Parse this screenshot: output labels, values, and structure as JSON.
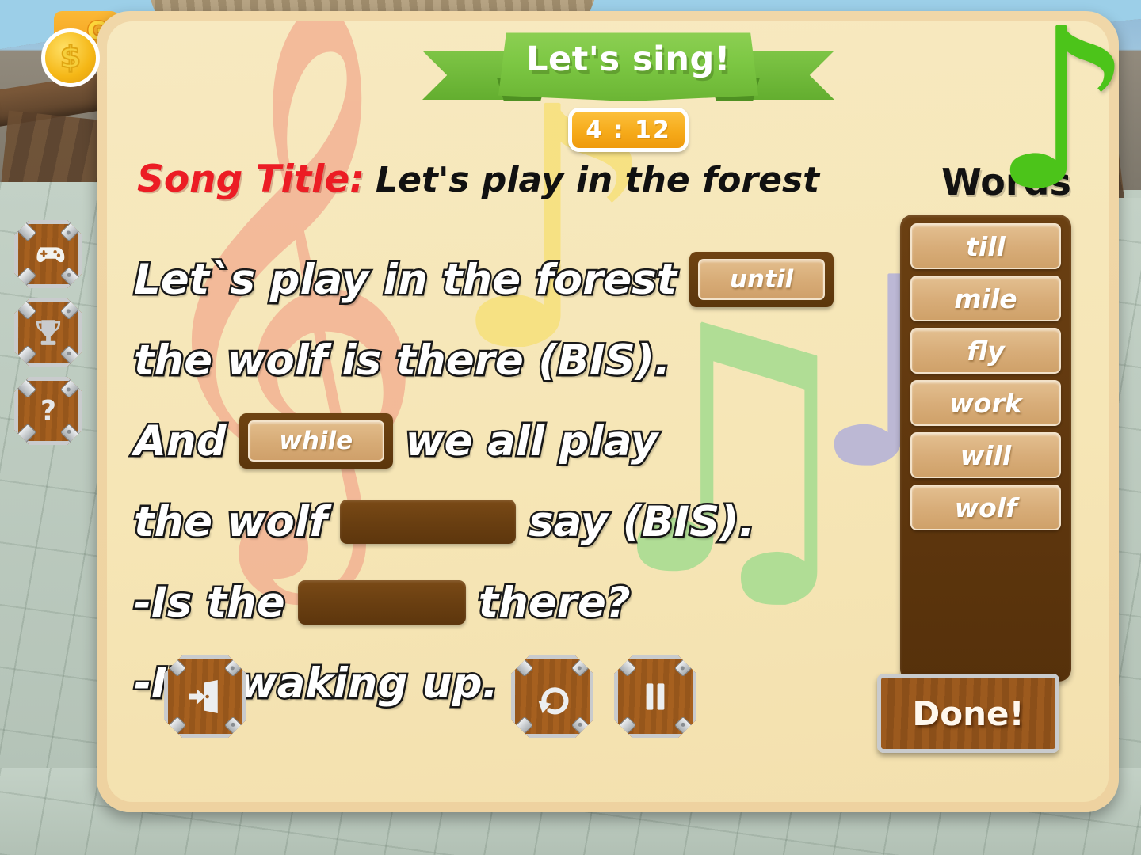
{
  "hud": {
    "gold_label": "Gold",
    "coin_icon": "gold-coin-icon"
  },
  "sidebar": {
    "items": [
      {
        "icon": "gamepad-icon",
        "name": "games"
      },
      {
        "icon": "trophy-icon",
        "name": "achievements"
      },
      {
        "icon": "question-mark-icon",
        "name": "help"
      }
    ]
  },
  "banner": {
    "title": "Let's sing!",
    "timer": "4 : 12"
  },
  "header": {
    "song_label": "Song Title:",
    "song_title": "Let's play in the forest",
    "words_heading": "Words"
  },
  "lyrics": [
    {
      "type": "line",
      "before": "Let`s play in the forest",
      "slot": "filled",
      "slot_value": "until",
      "after": ""
    },
    {
      "type": "line",
      "before": "the wolf is there (BIS).",
      "slot": "none",
      "slot_value": "",
      "after": ""
    },
    {
      "type": "line",
      "before": "And",
      "slot": "filled",
      "slot_value": "while",
      "after": "we all play"
    },
    {
      "type": "line",
      "before": "the wolf",
      "slot": "empty",
      "slot_value": "",
      "after": "say (BIS)."
    },
    {
      "type": "line",
      "before": "-Is the",
      "slot": "empty",
      "slot_value": "",
      "after": "there?"
    },
    {
      "type": "line",
      "before": "-I'm waking up.",
      "slot": "none",
      "slot_value": "",
      "after": ""
    }
  ],
  "words_panel": {
    "tiles": [
      "till",
      "mile",
      "fly",
      "work",
      "will",
      "wolf"
    ]
  },
  "controls": {
    "exit": {
      "icon": "exit-door-icon",
      "label": "Exit"
    },
    "replay": {
      "icon": "replay-icon",
      "label": "Replay"
    },
    "pause": {
      "icon": "pause-icon",
      "label": "Pause"
    },
    "done": {
      "label": "Done!"
    }
  },
  "decorations": {
    "corner_note": "♪",
    "clef": "𝄞",
    "note_yellow": "♪",
    "note_green": "♫",
    "note_purple": "♪"
  },
  "colors": {
    "banner_green": "#7cc743",
    "timer_orange": "#f6ab1b",
    "song_label_red": "#ec1c24",
    "panel_cream": "#f6e6b6",
    "panel_border_tan": "#eed2a0",
    "wood_brown": "#9c5a1e",
    "slot_dark_brown": "#6a3f11",
    "tile_tan": "#d8ad79",
    "corner_note_green": "#4cc41a"
  }
}
